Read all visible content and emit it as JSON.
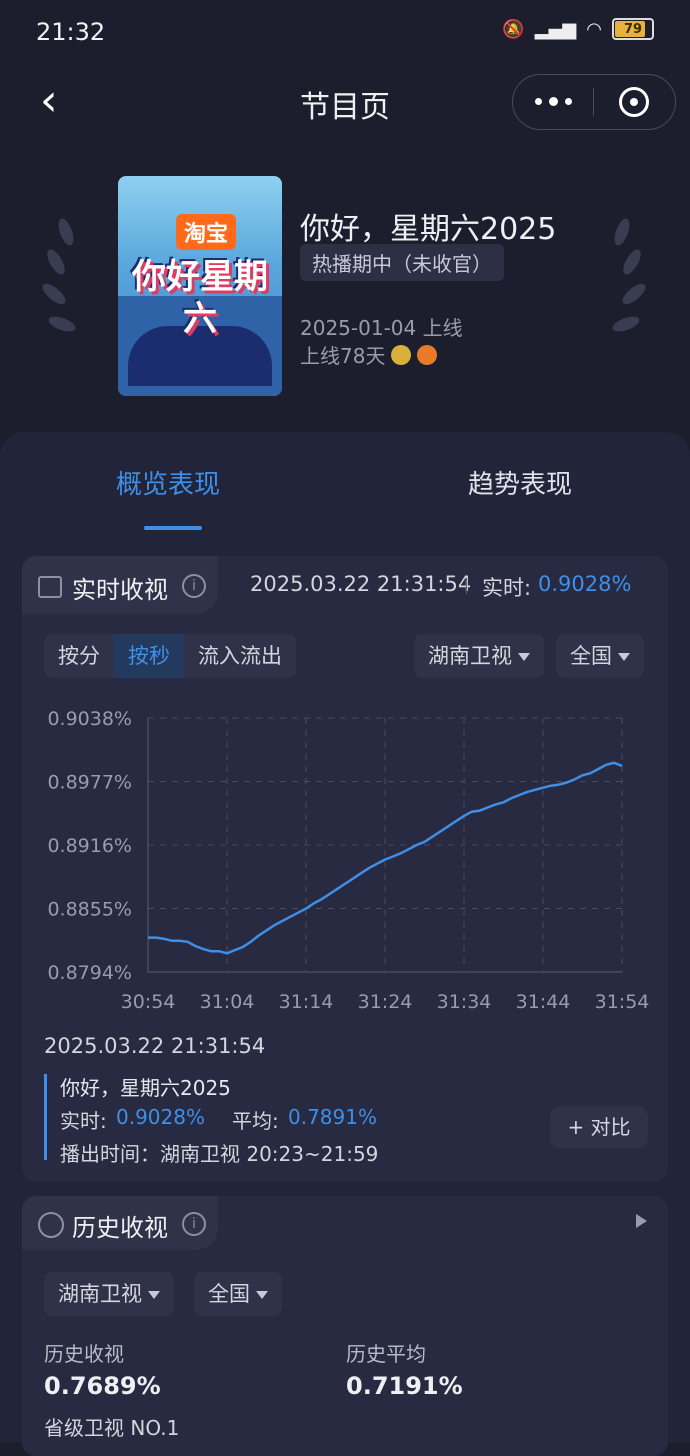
{
  "status_bar": {
    "time": "21:32",
    "battery": "79"
  },
  "nav": {
    "title": "节目页"
  },
  "show": {
    "title": "你好，星期六2025",
    "status": "热播期中（未收官）",
    "premiere": "2025-01-04 上线",
    "days_online": "上线78天",
    "poster_brand": "淘宝",
    "poster_text": "你好星期六"
  },
  "tabs": [
    {
      "label": "概览表现"
    },
    {
      "label": "趋势表现"
    }
  ],
  "realtime": {
    "title": "实时收视",
    "timestamp": "2025.03.22 21:31:54",
    "live_label": "实时:",
    "live_value": "0.9028%",
    "segments": [
      "按分",
      "按秒",
      "流入流出"
    ],
    "channel": "湖南卫视",
    "region": "全国"
  },
  "chart_data": {
    "type": "line",
    "x_ticks": [
      "30:54",
      "31:04",
      "31:14",
      "31:24",
      "31:34",
      "31:44",
      "31:54"
    ],
    "y_ticks": [
      "0.9038%",
      "0.8977%",
      "0.8916%",
      "0.8855%",
      "0.8794%"
    ],
    "ylim": [
      0.8794,
      0.9038
    ],
    "series": [
      {
        "color": "#3f8fe8",
        "x": [
          0,
          1,
          2,
          3,
          4,
          5,
          6,
          7,
          8,
          9,
          10,
          11,
          12,
          13,
          14,
          15,
          16,
          17,
          18,
          19,
          20,
          21,
          22,
          23,
          24,
          25,
          26,
          27,
          28,
          29,
          30,
          31,
          32,
          33,
          34,
          35,
          36,
          37,
          38,
          39,
          40,
          41,
          42,
          43,
          44,
          45,
          46,
          47,
          48,
          49,
          50,
          51,
          52,
          53,
          54,
          55,
          56,
          57,
          58,
          59,
          60
        ],
        "values": [
          0.8827,
          0.8827,
          0.8826,
          0.8824,
          0.8824,
          0.8823,
          0.8819,
          0.8816,
          0.8814,
          0.8814,
          0.8812,
          0.8815,
          0.8818,
          0.8823,
          0.8829,
          0.8834,
          0.8839,
          0.8843,
          0.8847,
          0.8851,
          0.8855,
          0.886,
          0.8864,
          0.8869,
          0.8874,
          0.8879,
          0.8884,
          0.8889,
          0.8894,
          0.8898,
          0.8902,
          0.8905,
          0.8908,
          0.8912,
          0.8916,
          0.8919,
          0.8924,
          0.8929,
          0.8934,
          0.8939,
          0.8944,
          0.8948,
          0.8949,
          0.8952,
          0.8955,
          0.8957,
          0.8961,
          0.8964,
          0.8967,
          0.8969,
          0.8971,
          0.8973,
          0.8974,
          0.8976,
          0.8979,
          0.8983,
          0.8985,
          0.8989,
          0.8993,
          0.8995,
          0.8992
        ]
      }
    ]
  },
  "tooltip": {
    "time": "2025.03.22 21:31:54",
    "name": "你好，星期六2025",
    "rt_label": "实时:",
    "rt_value": "0.9028%",
    "avg_label": "平均:",
    "avg_value": "0.7891%",
    "air": "播出时间：湖南卫视 20:23~21:59",
    "compare": "+ 对比"
  },
  "history": {
    "title": "历史收视",
    "channel": "湖南卫视",
    "region": "全国",
    "hist_label": "历史收视",
    "hist_value": "0.7689%",
    "avg_label": "历史平均",
    "avg_value": "0.7191%",
    "rank": "省级卫视 NO.1"
  },
  "colors": {
    "accent": "#3f8fe8",
    "background": "#1c1e2e",
    "card": "#272a40"
  }
}
